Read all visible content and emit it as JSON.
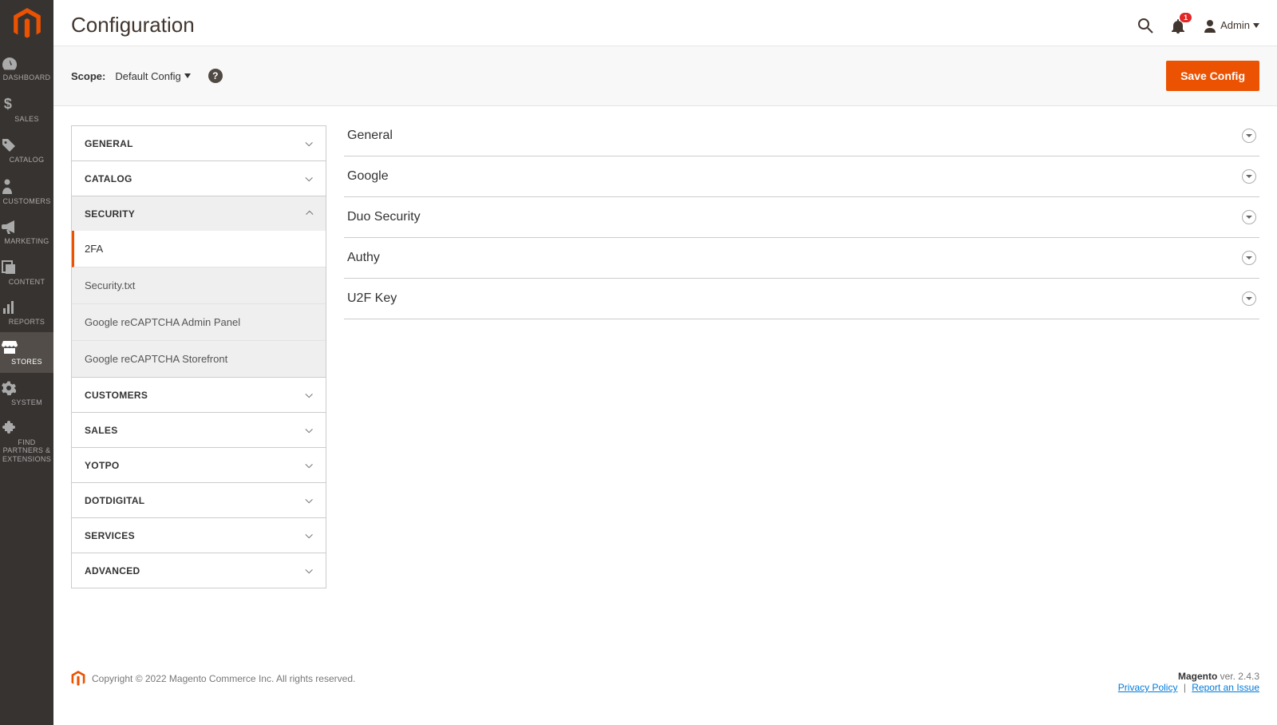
{
  "brand_color": "#eb5202",
  "sidenav": [
    {
      "id": "dashboard",
      "label": "DASHBOARD"
    },
    {
      "id": "sales",
      "label": "SALES"
    },
    {
      "id": "catalog",
      "label": "CATALOG"
    },
    {
      "id": "customers",
      "label": "CUSTOMERS"
    },
    {
      "id": "marketing",
      "label": "MARKETING"
    },
    {
      "id": "content",
      "label": "CONTENT"
    },
    {
      "id": "reports",
      "label": "REPORTS"
    },
    {
      "id": "stores",
      "label": "STORES",
      "active": true
    },
    {
      "id": "system",
      "label": "SYSTEM"
    },
    {
      "id": "find",
      "label": "FIND PARTNERS & EXTENSIONS"
    }
  ],
  "page_title": "Configuration",
  "notifications_count": "1",
  "admin_user": "Admin",
  "scope_label": "Scope:",
  "scope_value": "Default Config",
  "save_button": "Save Config",
  "tabs": [
    {
      "label": "GENERAL"
    },
    {
      "label": "CATALOG"
    },
    {
      "label": "SECURITY",
      "open": true,
      "items": [
        {
          "label": "2FA",
          "active": true
        },
        {
          "label": "Security.txt"
        },
        {
          "label": "Google reCAPTCHA Admin Panel"
        },
        {
          "label": "Google reCAPTCHA Storefront"
        }
      ]
    },
    {
      "label": "CUSTOMERS"
    },
    {
      "label": "SALES"
    },
    {
      "label": "YOTPO"
    },
    {
      "label": "DOTDIGITAL"
    },
    {
      "label": "SERVICES"
    },
    {
      "label": "ADVANCED"
    }
  ],
  "panels": [
    {
      "title": "General"
    },
    {
      "title": "Google"
    },
    {
      "title": "Duo Security"
    },
    {
      "title": "Authy"
    },
    {
      "title": "U2F Key"
    }
  ],
  "footer": {
    "copyright": "Copyright © 2022 Magento Commerce Inc. All rights reserved.",
    "product": "Magento",
    "version": " ver. 2.4.3",
    "privacy": "Privacy Policy",
    "report": "Report an Issue"
  }
}
